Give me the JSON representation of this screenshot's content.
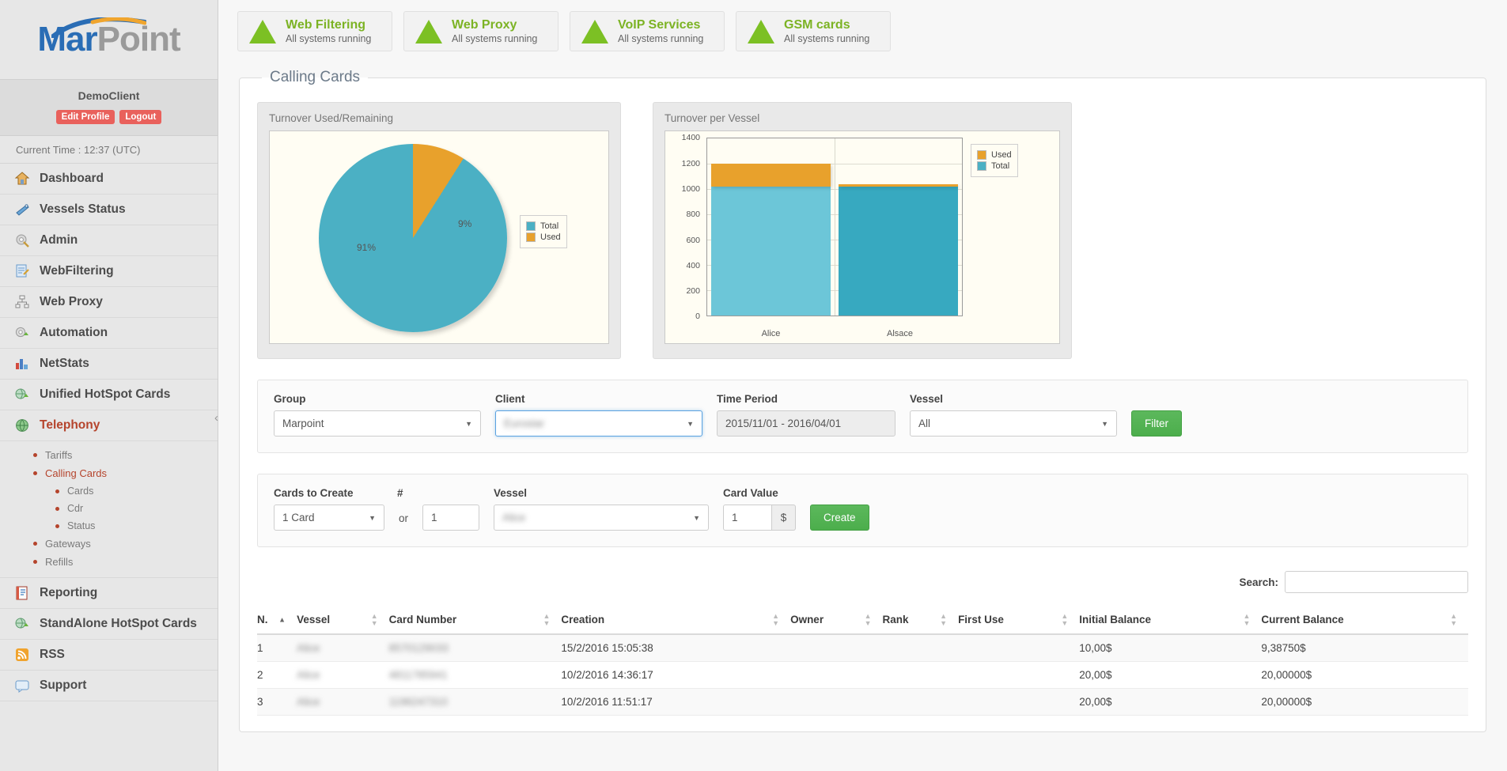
{
  "brand": {
    "part1": "Mar",
    "part2": "Point"
  },
  "user": {
    "name": "DemoClient",
    "edit_profile": "Edit Profile",
    "logout": "Logout"
  },
  "sidebar": {
    "current_time": "Current Time : 12:37 (UTC)",
    "items": [
      {
        "label": "Dashboard",
        "icon": "home-icon",
        "active": false
      },
      {
        "label": "Vessels Status",
        "icon": "ship-icon",
        "active": false
      },
      {
        "label": "Admin",
        "icon": "gear-icon",
        "active": false
      },
      {
        "label": "WebFiltering",
        "icon": "document-edit-icon",
        "active": false
      },
      {
        "label": "Web Proxy",
        "icon": "network-icon",
        "active": false
      },
      {
        "label": "Automation",
        "icon": "gear-arrow-icon",
        "active": false
      },
      {
        "label": "NetStats",
        "icon": "bar-chart-icon",
        "active": false
      },
      {
        "label": "Unified HotSpot Cards",
        "icon": "globe-arrow-icon",
        "active": false
      },
      {
        "label": "Telephony",
        "icon": "globe-icon",
        "active": true
      }
    ],
    "subitems": [
      {
        "label": "Tariffs",
        "level": 1,
        "active": false
      },
      {
        "label": "Calling Cards",
        "level": 1,
        "active": true
      },
      {
        "label": "Cards",
        "level": 2,
        "active": false
      },
      {
        "label": "Cdr",
        "level": 2,
        "active": false
      },
      {
        "label": "Status",
        "level": 2,
        "active": false
      },
      {
        "label": "Gateways",
        "level": 1,
        "active": false
      },
      {
        "label": "Refills",
        "level": 1,
        "active": false
      }
    ],
    "items_bottom": [
      {
        "label": "Reporting",
        "icon": "report-icon"
      },
      {
        "label": "StandAlone HotSpot Cards",
        "icon": "globe-arrow-icon"
      },
      {
        "label": "RSS",
        "icon": "rss-icon"
      },
      {
        "label": "Support",
        "icon": "support-icon"
      }
    ]
  },
  "status_cards": [
    {
      "title": "Web Filtering",
      "subtitle": "All systems running",
      "icon": "triangle-up-icon",
      "color": "#7cc024"
    },
    {
      "title": "Web Proxy",
      "subtitle": "All systems running",
      "icon": "triangle-up-icon",
      "color": "#7cc024"
    },
    {
      "title": "VoIP Services",
      "subtitle": "All systems running",
      "icon": "triangle-up-icon",
      "color": "#7cc024"
    },
    {
      "title": "GSM cards",
      "subtitle": "All systems running",
      "icon": "triangle-up-icon",
      "color": "#7cc024"
    }
  ],
  "panel": {
    "legend": "Calling Cards"
  },
  "chart_data": [
    {
      "type": "pie",
      "title": "Turnover Used/Remaining",
      "labels": [
        "Total",
        "Used"
      ],
      "values": [
        91,
        9
      ],
      "data_labels": [
        "91%",
        "9%"
      ],
      "colors": [
        "#4bb0c4",
        "#e8a12c"
      ],
      "legend_position": "right"
    },
    {
      "type": "bar",
      "title": "Turnover per Vessel",
      "categories": [
        "Alice",
        "Alsace"
      ],
      "series": [
        {
          "name": "Total",
          "values": [
            1020,
            1020
          ],
          "color": "#4bb0c4"
        },
        {
          "name": "Used",
          "values": [
            185,
            20
          ],
          "color": "#e8a12c"
        }
      ],
      "stacked": true,
      "ylim": [
        0,
        1400
      ],
      "yticks": [
        0,
        200,
        400,
        600,
        800,
        1000,
        1200,
        1400
      ],
      "xlabel": "",
      "ylabel": "",
      "grid": true,
      "legend_position": "right"
    }
  ],
  "filter_form": {
    "group_label": "Group",
    "group_value": "Marpoint",
    "client_label": "Client",
    "client_value": "Eurostar",
    "client_redacted": true,
    "time_label": "Time Period",
    "time_value": "2015/11/01 - 2016/04/01",
    "vessel_label": "Vessel",
    "vessel_value": "All",
    "filter_button": "Filter"
  },
  "create_form": {
    "cards_label": "Cards to Create",
    "cards_value": "1 Card",
    "hash_label": "#",
    "hash_value": "1",
    "or_text": "or",
    "vessel_label": "Vessel",
    "vessel_value": "Alice",
    "vessel_redacted": true,
    "value_label": "Card Value",
    "value_value": "1",
    "currency": "$",
    "create_button": "Create"
  },
  "table": {
    "search_label": "Search:",
    "search_value": "",
    "columns": [
      {
        "label": "N.",
        "sorted": true
      },
      {
        "label": "Vessel",
        "sorted": false
      },
      {
        "label": "Card Number",
        "sorted": false
      },
      {
        "label": "Creation",
        "sorted": false
      },
      {
        "label": "Owner",
        "sorted": false
      },
      {
        "label": "Rank",
        "sorted": false
      },
      {
        "label": "First Use",
        "sorted": false
      },
      {
        "label": "Initial Balance",
        "sorted": false
      },
      {
        "label": "Current Balance",
        "sorted": false
      }
    ],
    "rows": [
      {
        "n": "1",
        "vessel": "Alice",
        "card_number": "8570129033",
        "creation": "15/2/2016 15:05:38",
        "owner": "",
        "rank": "",
        "first_use": "",
        "initial_balance": "10,00$",
        "current_balance": "9,38750$",
        "redacted": true
      },
      {
        "n": "2",
        "vessel": "Alice",
        "card_number": "4811785941",
        "creation": "10/2/2016 14:36:17",
        "owner": "",
        "rank": "",
        "first_use": "",
        "initial_balance": "20,00$",
        "current_balance": "20,00000$",
        "redacted": true
      },
      {
        "n": "3",
        "vessel": "Alice",
        "card_number": "1196247310",
        "creation": "10/2/2016 11:51:17",
        "owner": "",
        "rank": "",
        "first_use": "",
        "initial_balance": "20,00$",
        "current_balance": "20,00000$",
        "redacted": true
      }
    ]
  }
}
